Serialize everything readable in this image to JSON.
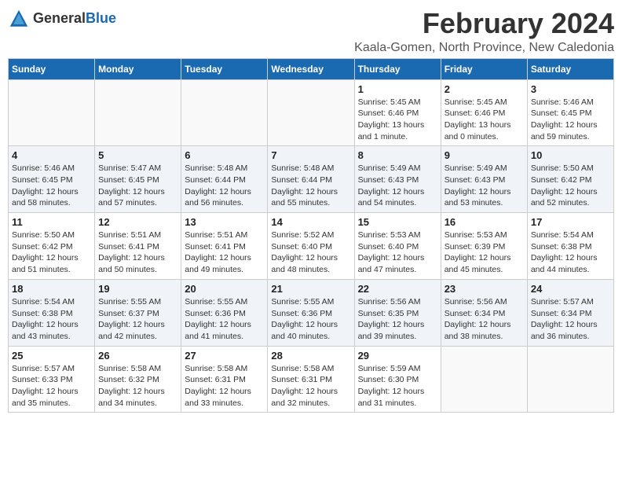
{
  "logo": {
    "general": "General",
    "blue": "Blue"
  },
  "title": "February 2024",
  "location": "Kaala-Gomen, North Province, New Caledonia",
  "days_of_week": [
    "Sunday",
    "Monday",
    "Tuesday",
    "Wednesday",
    "Thursday",
    "Friday",
    "Saturday"
  ],
  "weeks": [
    [
      {
        "day": "",
        "info": ""
      },
      {
        "day": "",
        "info": ""
      },
      {
        "day": "",
        "info": ""
      },
      {
        "day": "",
        "info": ""
      },
      {
        "day": "1",
        "info": "Sunrise: 5:45 AM\nSunset: 6:46 PM\nDaylight: 13 hours\nand 1 minute."
      },
      {
        "day": "2",
        "info": "Sunrise: 5:45 AM\nSunset: 6:46 PM\nDaylight: 13 hours\nand 0 minutes."
      },
      {
        "day": "3",
        "info": "Sunrise: 5:46 AM\nSunset: 6:45 PM\nDaylight: 12 hours\nand 59 minutes."
      }
    ],
    [
      {
        "day": "4",
        "info": "Sunrise: 5:46 AM\nSunset: 6:45 PM\nDaylight: 12 hours\nand 58 minutes."
      },
      {
        "day": "5",
        "info": "Sunrise: 5:47 AM\nSunset: 6:45 PM\nDaylight: 12 hours\nand 57 minutes."
      },
      {
        "day": "6",
        "info": "Sunrise: 5:48 AM\nSunset: 6:44 PM\nDaylight: 12 hours\nand 56 minutes."
      },
      {
        "day": "7",
        "info": "Sunrise: 5:48 AM\nSunset: 6:44 PM\nDaylight: 12 hours\nand 55 minutes."
      },
      {
        "day": "8",
        "info": "Sunrise: 5:49 AM\nSunset: 6:43 PM\nDaylight: 12 hours\nand 54 minutes."
      },
      {
        "day": "9",
        "info": "Sunrise: 5:49 AM\nSunset: 6:43 PM\nDaylight: 12 hours\nand 53 minutes."
      },
      {
        "day": "10",
        "info": "Sunrise: 5:50 AM\nSunset: 6:42 PM\nDaylight: 12 hours\nand 52 minutes."
      }
    ],
    [
      {
        "day": "11",
        "info": "Sunrise: 5:50 AM\nSunset: 6:42 PM\nDaylight: 12 hours\nand 51 minutes."
      },
      {
        "day": "12",
        "info": "Sunrise: 5:51 AM\nSunset: 6:41 PM\nDaylight: 12 hours\nand 50 minutes."
      },
      {
        "day": "13",
        "info": "Sunrise: 5:51 AM\nSunset: 6:41 PM\nDaylight: 12 hours\nand 49 minutes."
      },
      {
        "day": "14",
        "info": "Sunrise: 5:52 AM\nSunset: 6:40 PM\nDaylight: 12 hours\nand 48 minutes."
      },
      {
        "day": "15",
        "info": "Sunrise: 5:53 AM\nSunset: 6:40 PM\nDaylight: 12 hours\nand 47 minutes."
      },
      {
        "day": "16",
        "info": "Sunrise: 5:53 AM\nSunset: 6:39 PM\nDaylight: 12 hours\nand 45 minutes."
      },
      {
        "day": "17",
        "info": "Sunrise: 5:54 AM\nSunset: 6:38 PM\nDaylight: 12 hours\nand 44 minutes."
      }
    ],
    [
      {
        "day": "18",
        "info": "Sunrise: 5:54 AM\nSunset: 6:38 PM\nDaylight: 12 hours\nand 43 minutes."
      },
      {
        "day": "19",
        "info": "Sunrise: 5:55 AM\nSunset: 6:37 PM\nDaylight: 12 hours\nand 42 minutes."
      },
      {
        "day": "20",
        "info": "Sunrise: 5:55 AM\nSunset: 6:36 PM\nDaylight: 12 hours\nand 41 minutes."
      },
      {
        "day": "21",
        "info": "Sunrise: 5:55 AM\nSunset: 6:36 PM\nDaylight: 12 hours\nand 40 minutes."
      },
      {
        "day": "22",
        "info": "Sunrise: 5:56 AM\nSunset: 6:35 PM\nDaylight: 12 hours\nand 39 minutes."
      },
      {
        "day": "23",
        "info": "Sunrise: 5:56 AM\nSunset: 6:34 PM\nDaylight: 12 hours\nand 38 minutes."
      },
      {
        "day": "24",
        "info": "Sunrise: 5:57 AM\nSunset: 6:34 PM\nDaylight: 12 hours\nand 36 minutes."
      }
    ],
    [
      {
        "day": "25",
        "info": "Sunrise: 5:57 AM\nSunset: 6:33 PM\nDaylight: 12 hours\nand 35 minutes."
      },
      {
        "day": "26",
        "info": "Sunrise: 5:58 AM\nSunset: 6:32 PM\nDaylight: 12 hours\nand 34 minutes."
      },
      {
        "day": "27",
        "info": "Sunrise: 5:58 AM\nSunset: 6:31 PM\nDaylight: 12 hours\nand 33 minutes."
      },
      {
        "day": "28",
        "info": "Sunrise: 5:58 AM\nSunset: 6:31 PM\nDaylight: 12 hours\nand 32 minutes."
      },
      {
        "day": "29",
        "info": "Sunrise: 5:59 AM\nSunset: 6:30 PM\nDaylight: 12 hours\nand 31 minutes."
      },
      {
        "day": "",
        "info": ""
      },
      {
        "day": "",
        "info": ""
      }
    ]
  ]
}
